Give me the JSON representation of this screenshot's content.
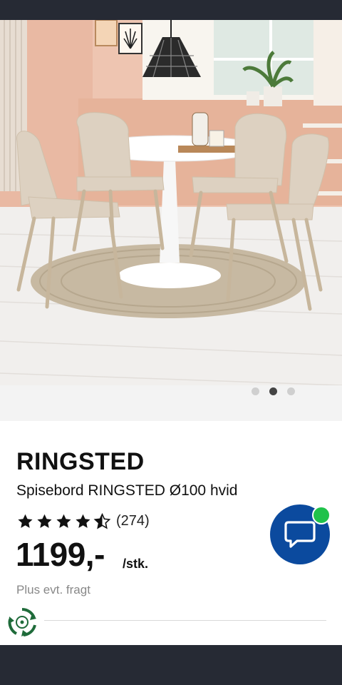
{
  "product": {
    "name": "RINGSTED",
    "description": "Spisebord RINGSTED Ø100 hvid",
    "rating": 4.5,
    "rating_max": 5,
    "reviews": "(274)",
    "price": "1199,-",
    "unit": "/stk.",
    "shipping_note": "Plus evt. fragt"
  },
  "carousel": {
    "count": 3,
    "active_index": 1
  },
  "icons": {
    "chat": "chat-bubble-icon",
    "eco": "recycle-leaf-icon",
    "star": "star-icon"
  },
  "colors": {
    "chat_button": "#0b4a9e",
    "online": "#1fc24a",
    "bars": "#262a34"
  }
}
